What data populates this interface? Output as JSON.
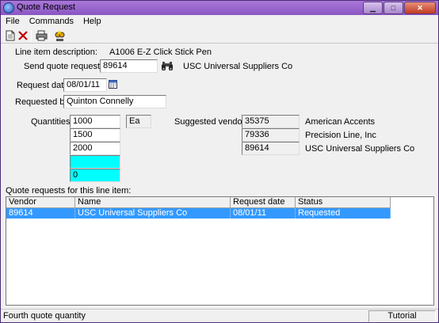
{
  "window": {
    "title": "Quote Request"
  },
  "menu": {
    "items": [
      "File",
      "Commands",
      "Help"
    ]
  },
  "toolbar": {
    "icons": [
      "new-document-icon",
      "delete-icon",
      "print-icon",
      "wizard-icon"
    ]
  },
  "form": {
    "line_item_label": "Line item description:",
    "line_item_value": "A1006 E-Z Click Stick Pen",
    "send_label": "Send quote request to:",
    "send_value": "89614",
    "send_vendor_name": "USC Universal Suppliers Co",
    "request_date_label": "Request date:",
    "request_date_value": "08/01/11",
    "requested_by_label": "Requested by:",
    "requested_by_value": "Quinton Connelly",
    "quantities_label": "Quantities:",
    "quantities": [
      "1000",
      "1500",
      "2000",
      "",
      "0"
    ],
    "unit": "Ea",
    "suggested_label": "Suggested vendors:",
    "suggested_vendors": [
      {
        "id": "35375",
        "name": "American Accents"
      },
      {
        "id": "79336",
        "name": "Precision Line, Inc"
      },
      {
        "id": "89614",
        "name": "USC Universal Suppliers Co"
      }
    ]
  },
  "quotes": {
    "section_label": "Quote requests for this line item:",
    "columns": [
      "Vendor",
      "Name",
      "Request date",
      "Status"
    ],
    "rows": [
      {
        "vendor": "89614",
        "name": "USC Universal Suppliers Co",
        "date": "08/01/11",
        "status": "Requested"
      }
    ]
  },
  "status": {
    "left": "Fourth quote quantity",
    "right": "Tutorial"
  }
}
